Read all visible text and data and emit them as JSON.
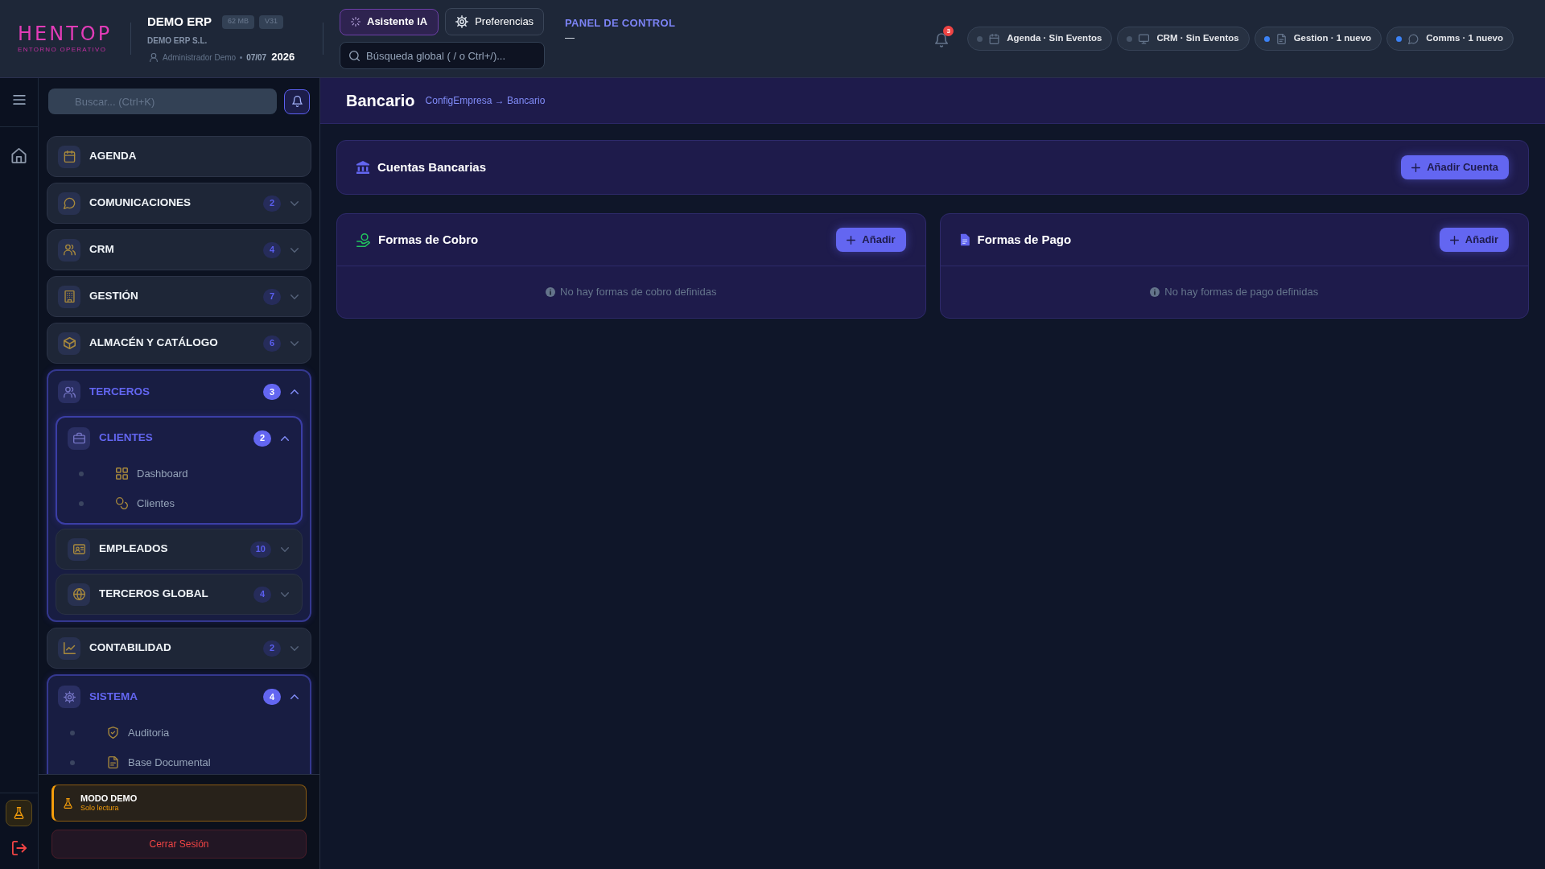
{
  "header": {
    "logo": {
      "wordmark": "HENTOP",
      "tagline": "ENTORNO OPERATIVO"
    },
    "app": {
      "title": "DEMO ERP",
      "tags": [
        "62 MB",
        "V31"
      ],
      "company": "DEMO ERP S.L.",
      "user": "Administrador Demo",
      "date": "07/07",
      "year": "2026"
    },
    "buttons": [
      {
        "label": "Asistente IA"
      },
      {
        "label": "Preferencias"
      }
    ],
    "search": {
      "placeholder": "Búsqueda global ( / o Ctrl+/)..."
    },
    "panel": {
      "title": "PANEL DE CONTROL",
      "subtitle": "—"
    },
    "notifications": {
      "count": "3"
    },
    "status_pills": [
      {
        "label": "Agenda · Sin Eventos",
        "color": "#475569"
      },
      {
        "label": "CRM · Sin Eventos",
        "color": "#475569"
      },
      {
        "label": "Gestion · 1 nuevo",
        "color": "#3b82f6"
      },
      {
        "label": "Comms · 1 nuevo",
        "color": "#3b82f6"
      }
    ]
  },
  "sidebar": {
    "search": {
      "placeholder": "Buscar... (Ctrl+K)"
    },
    "menu": [
      {
        "kind": "link",
        "label": "AGENDA"
      },
      {
        "kind": "group",
        "label": "COMUNICACIONES",
        "count": "2",
        "expanded": false
      },
      {
        "kind": "group",
        "label": "CRM",
        "count": "4",
        "expanded": false
      },
      {
        "kind": "group",
        "label": "GESTIÓN",
        "count": "7",
        "expanded": false
      },
      {
        "kind": "group",
        "label": "ALMACÉN Y CATÁLOGO",
        "count": "6",
        "expanded": false
      },
      {
        "kind": "group",
        "label": "TERCEROS",
        "count": "3",
        "expanded": true,
        "children": [
          {
            "kind": "group",
            "label": "CLIENTES",
            "count": "2",
            "expanded": true,
            "children": [
              {
                "kind": "link",
                "label": "Dashboard"
              },
              {
                "kind": "link",
                "label": "Clientes"
              }
            ]
          },
          {
            "kind": "group",
            "label": "EMPLEADOS",
            "count": "10",
            "expanded": false
          },
          {
            "kind": "group",
            "label": "TERCEROS GLOBAL",
            "count": "4",
            "expanded": false
          }
        ]
      },
      {
        "kind": "group",
        "label": "CONTABILIDAD",
        "count": "2",
        "expanded": false
      },
      {
        "kind": "group",
        "label": "SISTEMA",
        "count": "4",
        "expanded": true,
        "children": [
          {
            "kind": "link",
            "label": "Auditoria"
          },
          {
            "kind": "link",
            "label": "Base Documental"
          }
        ]
      }
    ],
    "demo_notice": {
      "title": "MODO DEMO",
      "subtitle": "Solo lectura"
    },
    "logout": {
      "label": "Cerrar Sesión"
    }
  },
  "page": {
    "title": "Bancario",
    "breadcrumb": "ConfigEmpresa → Bancario",
    "accounts_card": {
      "title": "Cuentas Bancarias",
      "button": "Añadir Cuenta"
    },
    "method_cards": [
      {
        "title": "Formas de Cobro",
        "button": "Añadir",
        "empty": "No hay formas de cobro definidas"
      },
      {
        "title": "Formas de Pago",
        "button": "Añadir",
        "empty": "No hay formas de pago definidas"
      }
    ]
  }
}
